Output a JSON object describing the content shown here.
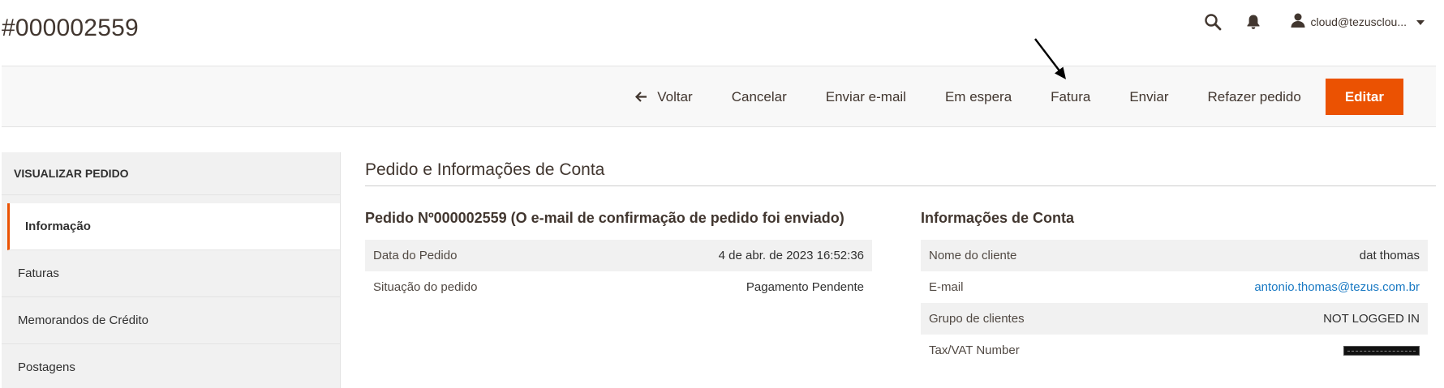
{
  "page": {
    "title": "#000002559"
  },
  "header": {
    "search_icon": "search-icon",
    "bell_icon": "bell-icon",
    "user_icon": "user-icon",
    "user_name": "cloud@tezusclou..."
  },
  "toolbar": {
    "back_label": "Voltar",
    "cancel_label": "Cancelar",
    "send_email_label": "Enviar e-mail",
    "hold_label": "Em espera",
    "invoice_label": "Fatura",
    "ship_label": "Enviar",
    "reorder_label": "Refazer pedido",
    "edit_label": "Editar"
  },
  "sidebar": {
    "title": "VISUALIZAR PEDIDO",
    "tabs": [
      {
        "label": "Informação",
        "active": true
      },
      {
        "label": "Faturas",
        "active": false
      },
      {
        "label": "Memorandos de Crédito",
        "active": false
      },
      {
        "label": "Postagens",
        "active": false
      }
    ]
  },
  "main": {
    "section_title": "Pedido e Informações de Conta",
    "order": {
      "title": "Pedido Nº000002559 (O e-mail de confirmação de pedido foi enviado)",
      "rows": [
        {
          "label": "Data do Pedido",
          "value": "4 de abr. de 2023 16:52:36"
        },
        {
          "label": "Situação do pedido",
          "value": "Pagamento Pendente"
        }
      ]
    },
    "account": {
      "title": "Informações de Conta",
      "rows": [
        {
          "label": "Nome do cliente",
          "value": "dat thomas"
        },
        {
          "label": "E-mail",
          "value": "antonio.thomas@tezus.com.br"
        },
        {
          "label": "Grupo de clientes",
          "value": "NOT LOGGED IN"
        },
        {
          "label": "Tax/VAT Number",
          "value": ""
        }
      ]
    }
  },
  "colors": {
    "accent": "#eb5202",
    "link": "#1979c3"
  }
}
